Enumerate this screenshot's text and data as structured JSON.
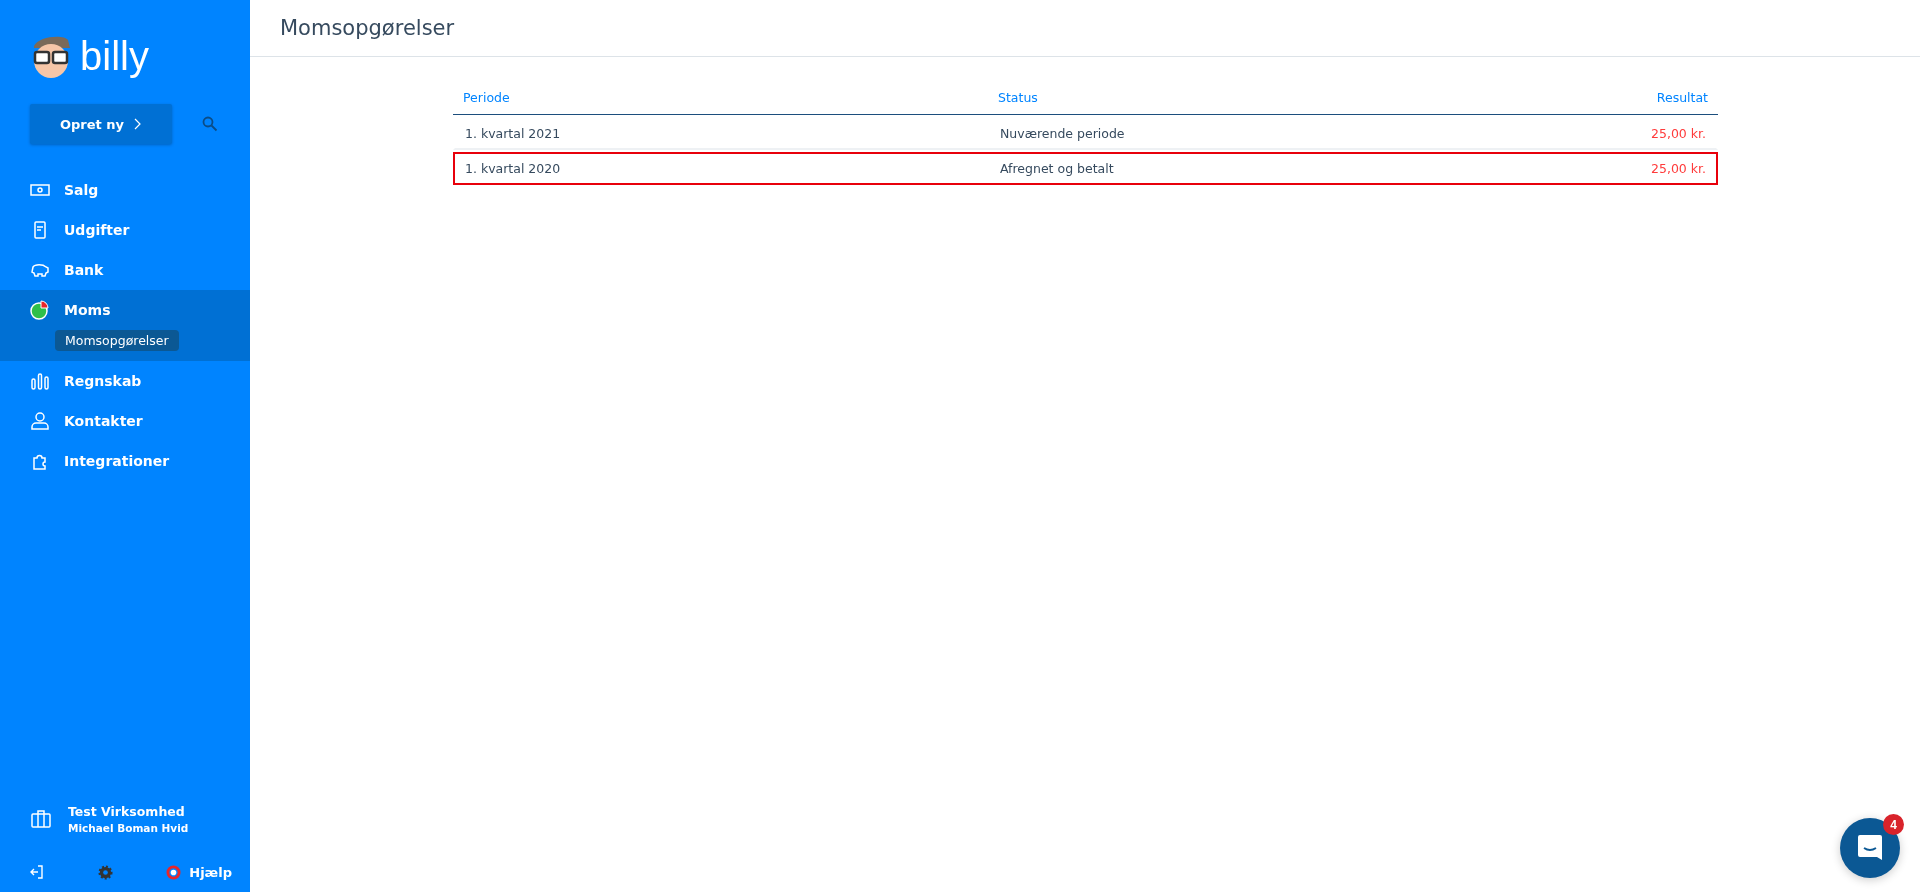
{
  "sidebar": {
    "logo_text": "billy",
    "create_button": "Opret ny",
    "items": [
      {
        "kind": "sales",
        "label": "Salg",
        "selected": false
      },
      {
        "kind": "expenses",
        "label": "Udgifter",
        "selected": false
      },
      {
        "kind": "bank",
        "label": "Bank",
        "selected": false
      },
      {
        "kind": "vat",
        "label": "Moms",
        "selected": true,
        "children": [
          {
            "label": "Momsopgørelser",
            "selected": true
          }
        ]
      },
      {
        "kind": "accounting",
        "label": "Regnskab",
        "selected": false
      },
      {
        "kind": "contacts",
        "label": "Kontakter",
        "selected": false
      },
      {
        "kind": "integrations",
        "label": "Integrationer",
        "selected": false
      }
    ],
    "company": {
      "name": "Test Virksomhed",
      "user": "Michael Boman Hvid"
    },
    "help": "Hjælp"
  },
  "page": {
    "title": "Momsopgørelser"
  },
  "table": {
    "columns": [
      "Periode",
      "Status",
      "Resultat"
    ],
    "rows": [
      {
        "period": "1. kvartal 2021",
        "status": "Nuværende periode",
        "result": "25,00 kr.",
        "highlighted": false
      },
      {
        "period": "1. kvartal 2020",
        "status": "Afregnet og betalt",
        "result": "25,00 kr.",
        "highlighted": true
      }
    ]
  },
  "chat": {
    "badge": "4"
  }
}
